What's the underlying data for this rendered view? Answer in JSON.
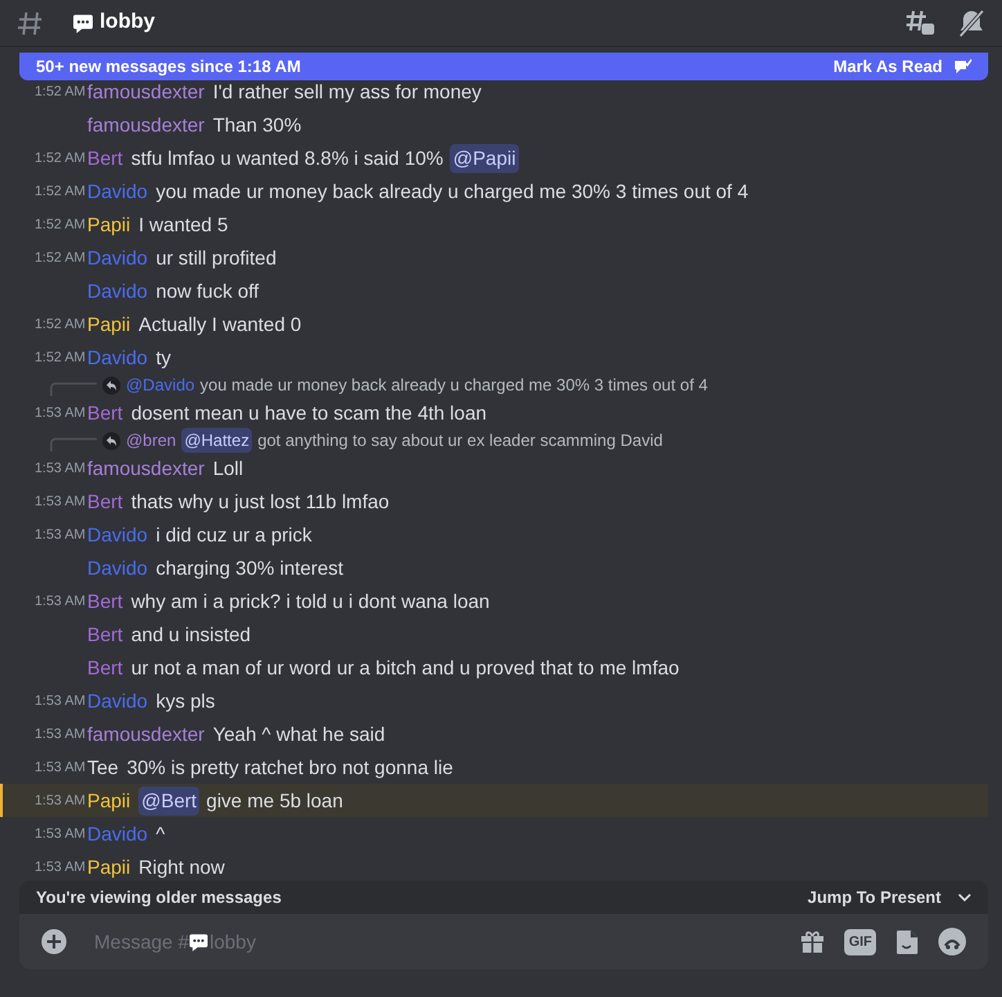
{
  "header": {
    "channel": "lobby"
  },
  "banner": {
    "text": "50+ new messages since 1:18 AM",
    "action": "Mark As Read"
  },
  "messages": [
    {
      "time": "1:52 AM",
      "author": "famousdexter",
      "color": "#a77fd9",
      "highlighted": false,
      "parts": [
        {
          "kind": "text",
          "text": "I'd rather sell my ass for money"
        }
      ]
    },
    {
      "author": "famousdexter",
      "color": "#a77fd9",
      "highlighted": false,
      "parts": [
        {
          "kind": "text",
          "text": "Than 30%"
        }
      ]
    },
    {
      "time": "1:52 AM",
      "author": "Bert",
      "color": "#a36ad6",
      "highlighted": false,
      "parts": [
        {
          "kind": "text",
          "text": "stfu lmfao u wanted 8.8% i said 10%"
        },
        {
          "kind": "mention",
          "text": "@Papii"
        }
      ]
    },
    {
      "time": "1:52 AM",
      "author": "Davido",
      "color": "#4a6cf0",
      "highlighted": false,
      "parts": [
        {
          "kind": "text",
          "text": "you made ur money back already u charged me 30% 3 times out of 4"
        }
      ]
    },
    {
      "time": "1:52 AM",
      "author": "Papii",
      "color": "#f0c23c",
      "highlighted": false,
      "parts": [
        {
          "kind": "text",
          "text": "I wanted 5"
        }
      ]
    },
    {
      "time": "1:52 AM",
      "author": "Davido",
      "color": "#4a6cf0",
      "highlighted": false,
      "parts": [
        {
          "kind": "text",
          "text": "ur still profited"
        }
      ]
    },
    {
      "author": "Davido",
      "color": "#4a6cf0",
      "highlighted": false,
      "parts": [
        {
          "kind": "text",
          "text": "now fuck off"
        }
      ]
    },
    {
      "time": "1:52 AM",
      "author": "Papii",
      "color": "#f0c23c",
      "highlighted": false,
      "parts": [
        {
          "kind": "text",
          "text": "Actually I wanted 0"
        }
      ]
    },
    {
      "time": "1:52 AM",
      "author": "Davido",
      "color": "#4a6cf0",
      "highlighted": false,
      "parts": [
        {
          "kind": "text",
          "text": "ty"
        }
      ]
    },
    {
      "reply": {
        "parts": [
          {
            "kind": "name",
            "text": "@Davido",
            "color": "#4a6cf0"
          },
          {
            "kind": "text",
            "text": "you made ur money back already u charged me 30% 3 times out of 4"
          }
        ]
      },
      "time": "1:53 AM",
      "author": "Bert",
      "color": "#a36ad6",
      "highlighted": false,
      "parts": [
        {
          "kind": "text",
          "text": "dosent mean u have to scam the 4th loan"
        }
      ]
    },
    {
      "reply": {
        "parts": [
          {
            "kind": "name",
            "text": "@bren",
            "color": "#a77fd9"
          },
          {
            "kind": "mention",
            "text": "@Hattez"
          },
          {
            "kind": "text",
            "text": "got anything to say about ur ex leader scamming David"
          }
        ]
      },
      "time": "1:53 AM",
      "author": "famousdexter",
      "color": "#a77fd9",
      "highlighted": false,
      "parts": [
        {
          "kind": "text",
          "text": "Loll"
        }
      ]
    },
    {
      "time": "1:53 AM",
      "author": "Bert",
      "color": "#a36ad6",
      "highlighted": false,
      "parts": [
        {
          "kind": "text",
          "text": "thats why u just lost 11b lmfao"
        }
      ]
    },
    {
      "time": "1:53 AM",
      "author": "Davido",
      "color": "#4a6cf0",
      "highlighted": false,
      "parts": [
        {
          "kind": "text",
          "text": "i did cuz ur a prick"
        }
      ]
    },
    {
      "author": "Davido",
      "color": "#4a6cf0",
      "highlighted": false,
      "parts": [
        {
          "kind": "text",
          "text": "charging 30% interest"
        }
      ]
    },
    {
      "time": "1:53 AM",
      "author": "Bert",
      "color": "#a36ad6",
      "highlighted": false,
      "parts": [
        {
          "kind": "text",
          "text": "why am i a prick? i told u i dont wana loan"
        }
      ]
    },
    {
      "author": "Bert",
      "color": "#a36ad6",
      "highlighted": false,
      "parts": [
        {
          "kind": "text",
          "text": "and u insisted"
        }
      ]
    },
    {
      "author": "Bert",
      "color": "#a36ad6",
      "highlighted": false,
      "parts": [
        {
          "kind": "text",
          "text": "ur not a man of ur word ur a bitch and u proved that to me lmfao"
        }
      ]
    },
    {
      "time": "1:53 AM",
      "author": "Davido",
      "color": "#4a6cf0",
      "highlighted": false,
      "parts": [
        {
          "kind": "text",
          "text": "kys pls"
        }
      ]
    },
    {
      "time": "1:53 AM",
      "author": "famousdexter",
      "color": "#a77fd9",
      "highlighted": false,
      "parts": [
        {
          "kind": "text",
          "text": "Yeah ^ what he said"
        }
      ]
    },
    {
      "time": "1:53 AM",
      "author": "Tee",
      "color": "#dbdee1",
      "highlighted": false,
      "parts": [
        {
          "kind": "text",
          "text": "30% is pretty ratchet bro not gonna lie"
        }
      ]
    },
    {
      "time": "1:53 AM",
      "author": "Papii",
      "color": "#f0c23c",
      "highlighted": true,
      "parts": [
        {
          "kind": "mention",
          "text": "@Bert"
        },
        {
          "kind": "text",
          "text": "give me 5b loan"
        }
      ]
    },
    {
      "time": "1:53 AM",
      "author": "Davido",
      "color": "#4a6cf0",
      "highlighted": false,
      "parts": [
        {
          "kind": "text",
          "text": "^"
        }
      ]
    },
    {
      "time": "1:53 AM",
      "author": "Papii",
      "color": "#f0c23c",
      "highlighted": false,
      "parts": [
        {
          "kind": "text",
          "text": "Right now"
        }
      ]
    }
  ],
  "older_bar": {
    "text": "You're viewing older messages",
    "action": "Jump To Present"
  },
  "composer": {
    "placeholder_start": "Message #",
    "placeholder_channel": "lobby",
    "gif_label": "GIF"
  }
}
